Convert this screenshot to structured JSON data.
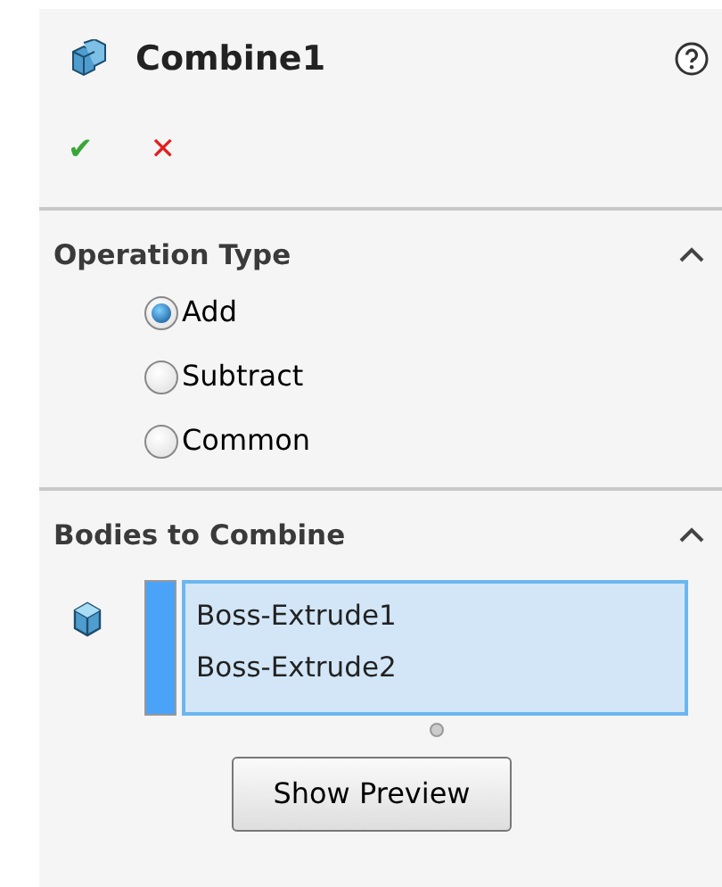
{
  "title": "Combine1",
  "actions": [
    {
      "kind": "ok",
      "label": "✔"
    },
    {
      "kind": "cancel",
      "label": "✕"
    }
  ],
  "operation_type": {
    "heading": "Operation Type",
    "expanded": true,
    "options": [
      {
        "label": "Add",
        "selected": true
      },
      {
        "label": "Subtract",
        "selected": false
      },
      {
        "label": "Common",
        "selected": false
      }
    ]
  },
  "bodies": {
    "heading": "Bodies to Combine",
    "expanded": true,
    "items": [
      {
        "label": "Boss-Extrude1"
      },
      {
        "label": "Boss-Extrude2"
      }
    ],
    "list_active": true
  },
  "preview_button": "Show Preview"
}
